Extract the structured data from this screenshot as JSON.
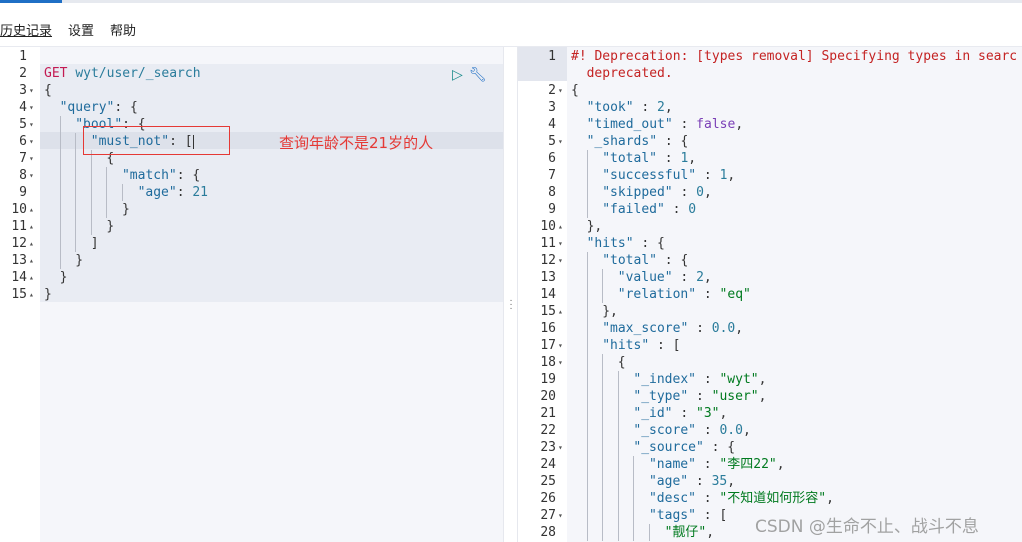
{
  "menu": {
    "items": [
      "历史记录",
      "设置",
      "帮助"
    ]
  },
  "request": {
    "lines": [
      {
        "n": "1",
        "indent": 0,
        "fold": false,
        "tokens": []
      },
      {
        "n": "2",
        "indent": 0,
        "fold": false,
        "tokens": [
          [
            "meth",
            "GET "
          ],
          [
            "url",
            "wyt/user/_search"
          ]
        ]
      },
      {
        "n": "3",
        "indent": 0,
        "fold": true,
        "tokens": [
          [
            "p",
            "{"
          ]
        ]
      },
      {
        "n": "4",
        "indent": 1,
        "fold": true,
        "tokens": [
          [
            "key",
            "\"query\""
          ],
          [
            "p",
            ": {"
          ]
        ]
      },
      {
        "n": "5",
        "indent": 2,
        "fold": true,
        "tokens": [
          [
            "key",
            "\"bool\""
          ],
          [
            "p",
            ": {"
          ]
        ]
      },
      {
        "n": "6",
        "indent": 3,
        "fold": true,
        "tokens": [
          [
            "key",
            "\"must_not\""
          ],
          [
            "p",
            ": ["
          ]
        ]
      },
      {
        "n": "7",
        "indent": 4,
        "fold": true,
        "tokens": [
          [
            "p",
            "{"
          ]
        ]
      },
      {
        "n": "8",
        "indent": 5,
        "fold": true,
        "tokens": [
          [
            "key",
            "\"match\""
          ],
          [
            "p",
            ": {"
          ]
        ]
      },
      {
        "n": "9",
        "indent": 6,
        "fold": false,
        "tokens": [
          [
            "key",
            "\"age\""
          ],
          [
            "p",
            ": "
          ],
          [
            "num",
            "21"
          ]
        ]
      },
      {
        "n": "10",
        "indent": 5,
        "fold": "up",
        "tokens": [
          [
            "p",
            "}"
          ]
        ]
      },
      {
        "n": "11",
        "indent": 4,
        "fold": "up",
        "tokens": [
          [
            "p",
            "}"
          ]
        ]
      },
      {
        "n": "12",
        "indent": 3,
        "fold": "up",
        "tokens": [
          [
            "p",
            "]"
          ]
        ]
      },
      {
        "n": "13",
        "indent": 2,
        "fold": "up",
        "tokens": [
          [
            "p",
            "}"
          ]
        ]
      },
      {
        "n": "14",
        "indent": 1,
        "fold": "up",
        "tokens": [
          [
            "p",
            "}"
          ]
        ]
      },
      {
        "n": "15",
        "indent": 0,
        "fold": "up",
        "tokens": [
          [
            "p",
            "}"
          ]
        ]
      }
    ]
  },
  "annotation": "查询年龄不是21岁的人",
  "response": {
    "lines": [
      {
        "n": "1",
        "indent": 0,
        "fold": false,
        "tokens": [
          [
            "warn",
            "#! Deprecation: [types removal] Specifying types in searc"
          ]
        ]
      },
      {
        "n": "",
        "indent": 1,
        "fold": false,
        "tokens": [
          [
            "warn",
            "deprecated."
          ]
        ]
      },
      {
        "n": "2",
        "indent": 0,
        "fold": true,
        "tokens": [
          [
            "p",
            "{"
          ]
        ]
      },
      {
        "n": "3",
        "indent": 1,
        "fold": false,
        "tokens": [
          [
            "key",
            "\"took\""
          ],
          [
            "p",
            " : "
          ],
          [
            "num",
            "2"
          ],
          [
            "p",
            ","
          ]
        ]
      },
      {
        "n": "4",
        "indent": 1,
        "fold": false,
        "tokens": [
          [
            "key",
            "\"timed_out\""
          ],
          [
            "p",
            " : "
          ],
          [
            "kw",
            "false"
          ],
          [
            "p",
            ","
          ]
        ]
      },
      {
        "n": "5",
        "indent": 1,
        "fold": true,
        "tokens": [
          [
            "key",
            "\"_shards\""
          ],
          [
            "p",
            " : {"
          ]
        ]
      },
      {
        "n": "6",
        "indent": 2,
        "fold": false,
        "tokens": [
          [
            "key",
            "\"total\""
          ],
          [
            "p",
            " : "
          ],
          [
            "num",
            "1"
          ],
          [
            "p",
            ","
          ]
        ]
      },
      {
        "n": "7",
        "indent": 2,
        "fold": false,
        "tokens": [
          [
            "key",
            "\"successful\""
          ],
          [
            "p",
            " : "
          ],
          [
            "num",
            "1"
          ],
          [
            "p",
            ","
          ]
        ]
      },
      {
        "n": "8",
        "indent": 2,
        "fold": false,
        "tokens": [
          [
            "key",
            "\"skipped\""
          ],
          [
            "p",
            " : "
          ],
          [
            "num",
            "0"
          ],
          [
            "p",
            ","
          ]
        ]
      },
      {
        "n": "9",
        "indent": 2,
        "fold": false,
        "tokens": [
          [
            "key",
            "\"failed\""
          ],
          [
            "p",
            " : "
          ],
          [
            "num",
            "0"
          ]
        ]
      },
      {
        "n": "10",
        "indent": 1,
        "fold": "up",
        "tokens": [
          [
            "p",
            "},"
          ]
        ]
      },
      {
        "n": "11",
        "indent": 1,
        "fold": true,
        "tokens": [
          [
            "key",
            "\"hits\""
          ],
          [
            "p",
            " : {"
          ]
        ]
      },
      {
        "n": "12",
        "indent": 2,
        "fold": true,
        "tokens": [
          [
            "key",
            "\"total\""
          ],
          [
            "p",
            " : {"
          ]
        ]
      },
      {
        "n": "13",
        "indent": 3,
        "fold": false,
        "tokens": [
          [
            "key",
            "\"value\""
          ],
          [
            "p",
            " : "
          ],
          [
            "num",
            "2"
          ],
          [
            "p",
            ","
          ]
        ]
      },
      {
        "n": "14",
        "indent": 3,
        "fold": false,
        "tokens": [
          [
            "key",
            "\"relation\""
          ],
          [
            "p",
            " : "
          ],
          [
            "str",
            "\"eq\""
          ]
        ]
      },
      {
        "n": "15",
        "indent": 2,
        "fold": "up",
        "tokens": [
          [
            "p",
            "},"
          ]
        ]
      },
      {
        "n": "16",
        "indent": 2,
        "fold": false,
        "tokens": [
          [
            "key",
            "\"max_score\""
          ],
          [
            "p",
            " : "
          ],
          [
            "num",
            "0.0"
          ],
          [
            "p",
            ","
          ]
        ]
      },
      {
        "n": "17",
        "indent": 2,
        "fold": true,
        "tokens": [
          [
            "key",
            "\"hits\""
          ],
          [
            "p",
            " : ["
          ]
        ]
      },
      {
        "n": "18",
        "indent": 3,
        "fold": true,
        "tokens": [
          [
            "p",
            "{"
          ]
        ]
      },
      {
        "n": "19",
        "indent": 4,
        "fold": false,
        "tokens": [
          [
            "key",
            "\"_index\""
          ],
          [
            "p",
            " : "
          ],
          [
            "str",
            "\"wyt\""
          ],
          [
            "p",
            ","
          ]
        ]
      },
      {
        "n": "20",
        "indent": 4,
        "fold": false,
        "tokens": [
          [
            "key",
            "\"_type\""
          ],
          [
            "p",
            " : "
          ],
          [
            "str",
            "\"user\""
          ],
          [
            "p",
            ","
          ]
        ]
      },
      {
        "n": "21",
        "indent": 4,
        "fold": false,
        "tokens": [
          [
            "key",
            "\"_id\""
          ],
          [
            "p",
            " : "
          ],
          [
            "str",
            "\"3\""
          ],
          [
            "p",
            ","
          ]
        ]
      },
      {
        "n": "22",
        "indent": 4,
        "fold": false,
        "tokens": [
          [
            "key",
            "\"_score\""
          ],
          [
            "p",
            " : "
          ],
          [
            "num",
            "0.0"
          ],
          [
            "p",
            ","
          ]
        ]
      },
      {
        "n": "23",
        "indent": 4,
        "fold": true,
        "tokens": [
          [
            "key",
            "\"_source\""
          ],
          [
            "p",
            " : {"
          ]
        ]
      },
      {
        "n": "24",
        "indent": 5,
        "fold": false,
        "tokens": [
          [
            "key",
            "\"name\""
          ],
          [
            "p",
            " : "
          ],
          [
            "str",
            "\"李四22\""
          ],
          [
            "p",
            ","
          ]
        ]
      },
      {
        "n": "25",
        "indent": 5,
        "fold": false,
        "tokens": [
          [
            "key",
            "\"age\""
          ],
          [
            "p",
            " : "
          ],
          [
            "num",
            "35"
          ],
          [
            "p",
            ","
          ]
        ]
      },
      {
        "n": "26",
        "indent": 5,
        "fold": false,
        "tokens": [
          [
            "key",
            "\"desc\""
          ],
          [
            "p",
            " : "
          ],
          [
            "str",
            "\"不知道如何形容\""
          ],
          [
            "p",
            ","
          ]
        ]
      },
      {
        "n": "27",
        "indent": 5,
        "fold": true,
        "tokens": [
          [
            "key",
            "\"tags\""
          ],
          [
            "p",
            " : ["
          ]
        ]
      },
      {
        "n": "28",
        "indent": 6,
        "fold": false,
        "tokens": [
          [
            "str",
            "\"靓仔\""
          ],
          [
            "p",
            ","
          ]
        ]
      }
    ]
  },
  "watermark": "CSDN @生命不止、战斗不息"
}
